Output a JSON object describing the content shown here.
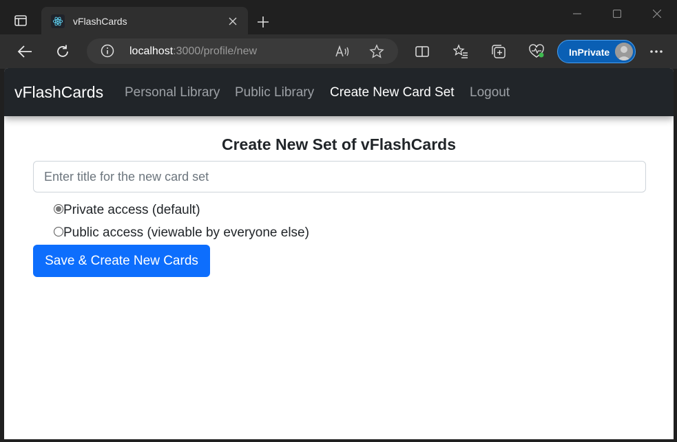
{
  "browser": {
    "tab_title": "vFlashCards",
    "url_host": "localhost",
    "url_rest": ":3000/profile/new",
    "inprivate_label": "InPrivate"
  },
  "navbar": {
    "brand": "vFlashCards",
    "links": [
      {
        "label": "Personal Library",
        "active": false
      },
      {
        "label": "Public Library",
        "active": false
      },
      {
        "label": "Create New Card Set",
        "active": true
      },
      {
        "label": "Logout",
        "active": false
      }
    ]
  },
  "form": {
    "heading": "Create New Set of vFlashCards",
    "title_placeholder": "Enter title for the new card set",
    "title_value": "",
    "options": [
      {
        "label": "Private access (default)",
        "checked": true
      },
      {
        "label": "Public access (viewable by everyone else)",
        "checked": false
      }
    ],
    "submit_label": "Save & Create New Cards"
  },
  "colors": {
    "navbar_bg": "#212529",
    "primary": "#0d6efd",
    "inprivate": "#0a5fb4"
  }
}
